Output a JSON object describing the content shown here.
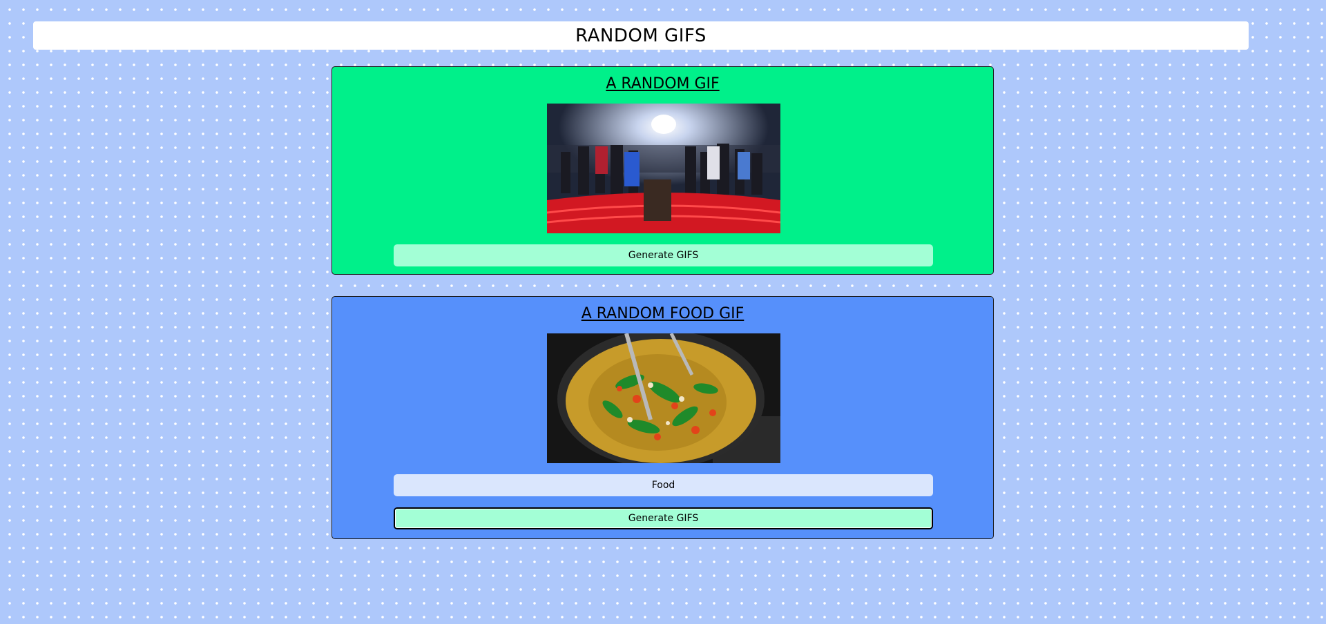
{
  "header": {
    "title": "RANDOM GIFS"
  },
  "random_card": {
    "title": "A RANDOM GIF",
    "button_label": "Generate GIFS",
    "background_color": "#00f08a"
  },
  "food_card": {
    "title": "A RANDOM FOOD GIF",
    "tag_input_value": "Food",
    "button_label": "Generate GIFS",
    "background_color": "#5690fb"
  },
  "colors": {
    "page_background": "#aec8fb",
    "button_background": "#a3ffd6",
    "input_background": "#dae6fd"
  }
}
